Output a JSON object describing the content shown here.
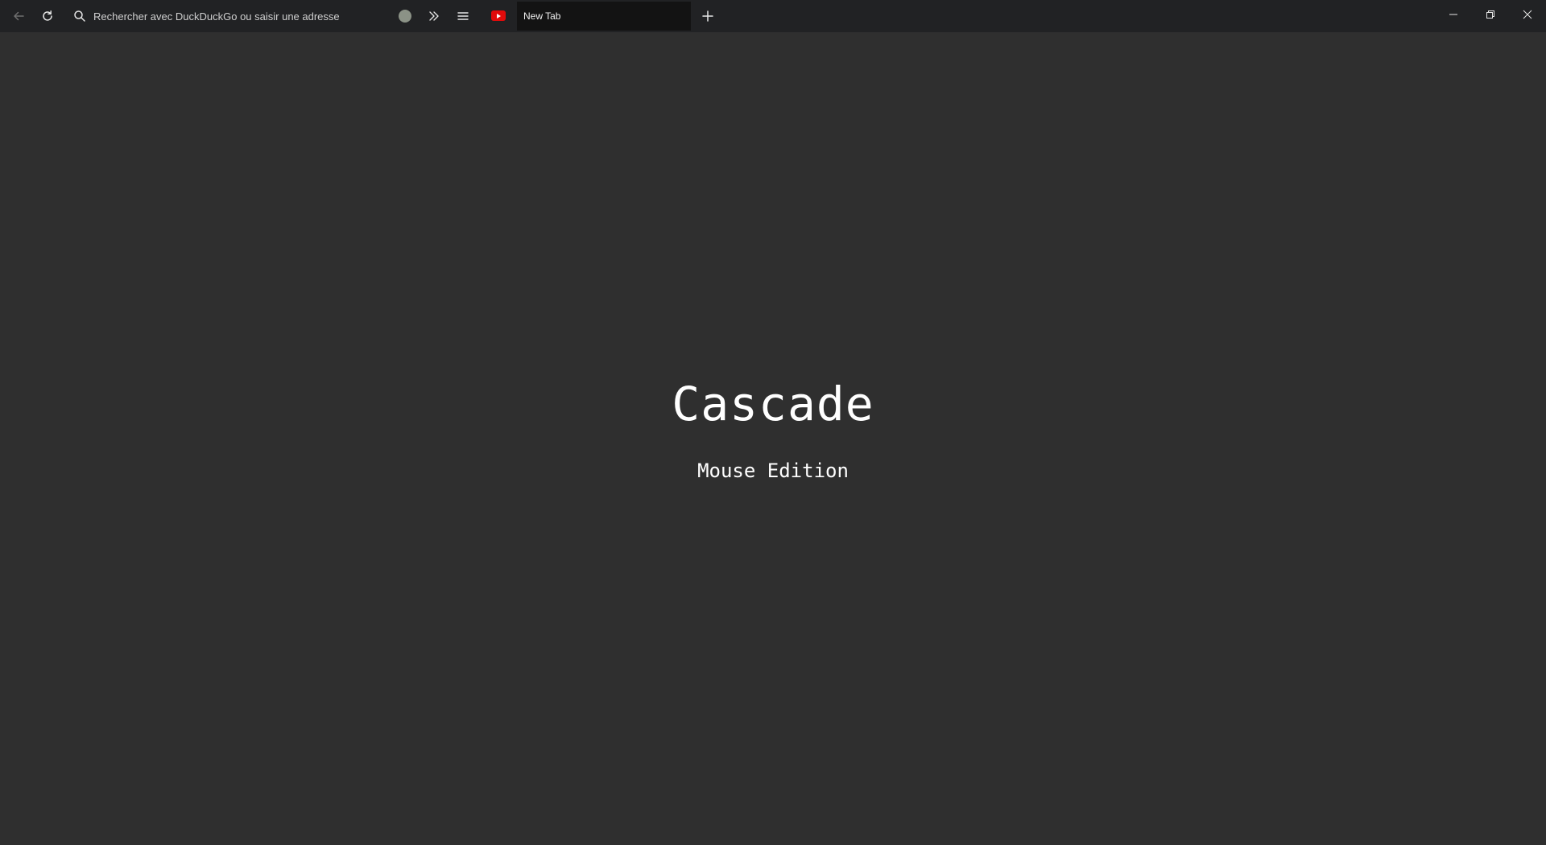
{
  "toolbar": {
    "back_icon": "arrow-left-icon",
    "reload_icon": "reload-icon",
    "search_icon": "search-icon",
    "url_placeholder": "Rechercher avec DuckDuckGo ou saisir une adresse",
    "url_value": "",
    "status_dot_color": "#8b9286",
    "overflow_icon": "double-chevron-right-icon",
    "menu_icon": "hamburger-menu-icon"
  },
  "tabs": [
    {
      "label": "New Tab",
      "favicon": "youtube-icon",
      "active": true
    }
  ],
  "new_tab_icon": "plus-icon",
  "window_controls": {
    "minimize_icon": "minimize-icon",
    "restore_icon": "restore-icon",
    "close_icon": "close-icon"
  },
  "page": {
    "title": "Cascade",
    "subtitle": "Mouse Edition"
  },
  "colors": {
    "toolbar_bg": "#212224",
    "page_bg": "#2f2f2f",
    "active_tab_bg": "#131313",
    "youtube_red": "#e10b0b"
  }
}
